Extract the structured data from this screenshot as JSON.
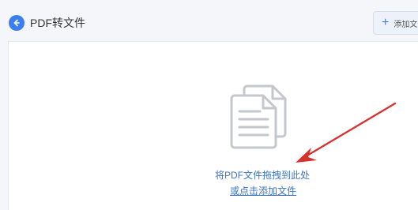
{
  "header": {
    "title": "PDF转文件",
    "add_file_label": "添加文件"
  },
  "drop_area": {
    "drop_hint": "将PDF文件拖拽到此处",
    "click_to_add": "或点击添加文件"
  },
  "colors": {
    "accent": "#3b7ef2",
    "link": "#3b74c4",
    "arrow": "#d9302c",
    "icon_gray": "#c4c7cc"
  },
  "icons": {
    "back": "back-arrow-icon",
    "add": "plus-icon",
    "document": "documents-icon",
    "annotation": "red-arrow-annotation"
  }
}
